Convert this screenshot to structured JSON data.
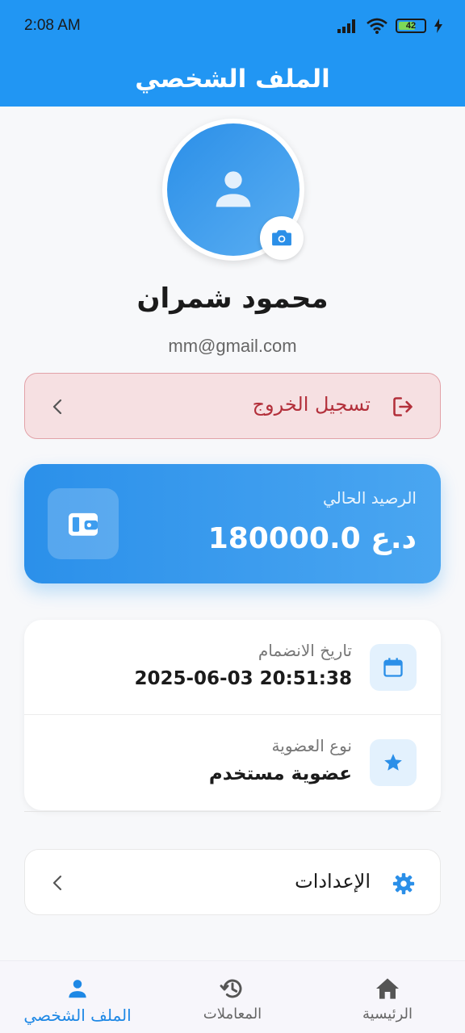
{
  "status_bar": {
    "time": "2:08 AM",
    "battery": "42",
    "icons": [
      "signal-icon",
      "wifi-icon",
      "battery-icon",
      "charging-icon"
    ]
  },
  "app_bar": {
    "title": "الملف الشخصي"
  },
  "profile": {
    "name": "محمود شمران",
    "email": "mm@gmail.com"
  },
  "logout": {
    "label": "تسجيل الخروج"
  },
  "balance": {
    "label": "الرصيد الحالي",
    "amount": "180000.0 د.ع"
  },
  "info": {
    "joined": {
      "label": "تاريخ الانضمام",
      "value": "2025-06-03 20:51:38"
    },
    "membership": {
      "label": "نوع العضوية",
      "value": "عضوية مستخدم"
    }
  },
  "settings": {
    "label": "الإعدادات"
  },
  "bottom_nav": {
    "items": [
      {
        "label": "الملف الشخصي",
        "icon": "person-icon",
        "active": true
      },
      {
        "label": "المعاملات",
        "icon": "history-icon",
        "active": false
      },
      {
        "label": "الرئيسية",
        "icon": "home-icon",
        "active": false
      }
    ]
  },
  "colors": {
    "primary": "#2196f3",
    "danger": "#b3303b",
    "danger_bg": "#f6e0e2",
    "active_nav": "#1e88e5"
  }
}
